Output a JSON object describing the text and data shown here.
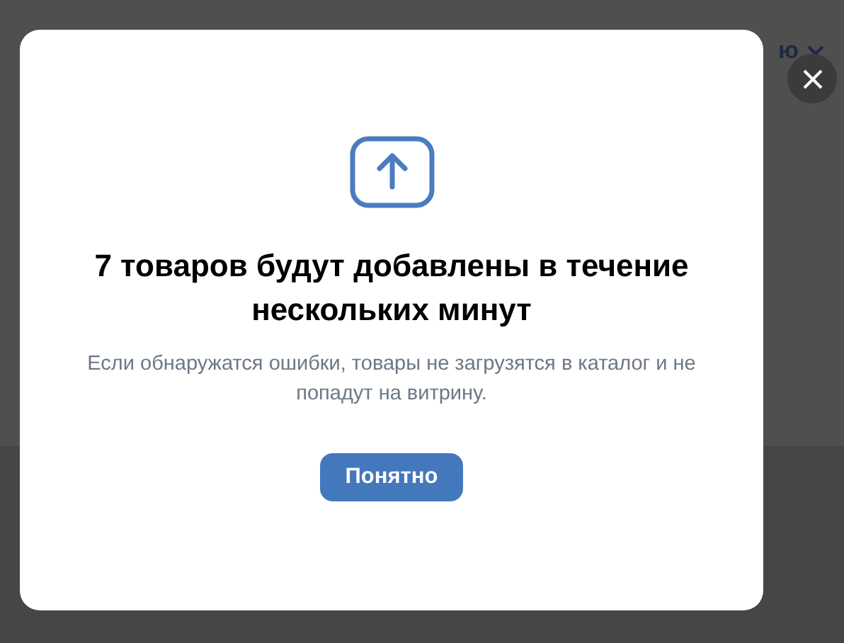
{
  "background": {
    "menu_text": "ю"
  },
  "dialog": {
    "title": "7 товаров будут добавлены в течение нескольких минут",
    "message": "Если обнаружатся ошибки, товары не загрузятся в каталог и не попадут на витрину.",
    "button": "Понятно"
  }
}
